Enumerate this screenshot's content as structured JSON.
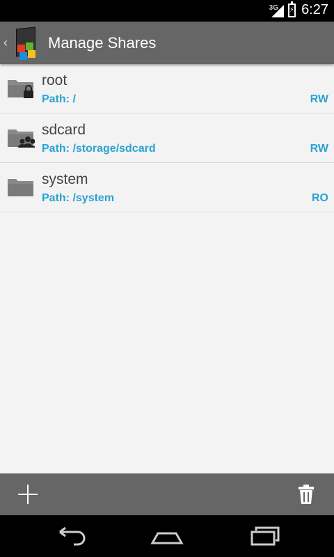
{
  "status_bar": {
    "network": "3G",
    "time": "6:27"
  },
  "action_bar": {
    "title": "Manage Shares",
    "icon": "app-icon"
  },
  "shares": [
    {
      "name": "root",
      "path": "Path: /",
      "mode": "RW",
      "icon": "folder-lock-icon"
    },
    {
      "name": "sdcard",
      "path": "Path: /storage/sdcard",
      "mode": "RW",
      "icon": "folder-users-icon"
    },
    {
      "name": "system",
      "path": "Path: /system",
      "mode": "RO",
      "icon": "folder-icon"
    }
  ],
  "fab": {
    "label": "+",
    "icon": "plus-icon"
  },
  "bottom_bar": {
    "add_icon": "add-icon",
    "delete_icon": "trash-icon"
  },
  "nav_bar": {
    "back_icon": "back-icon",
    "home_icon": "home-icon",
    "recents_icon": "recents-icon"
  },
  "colors": {
    "accent": "#2aa3d3",
    "bar": "#666666",
    "background": "#f3f3f3"
  }
}
